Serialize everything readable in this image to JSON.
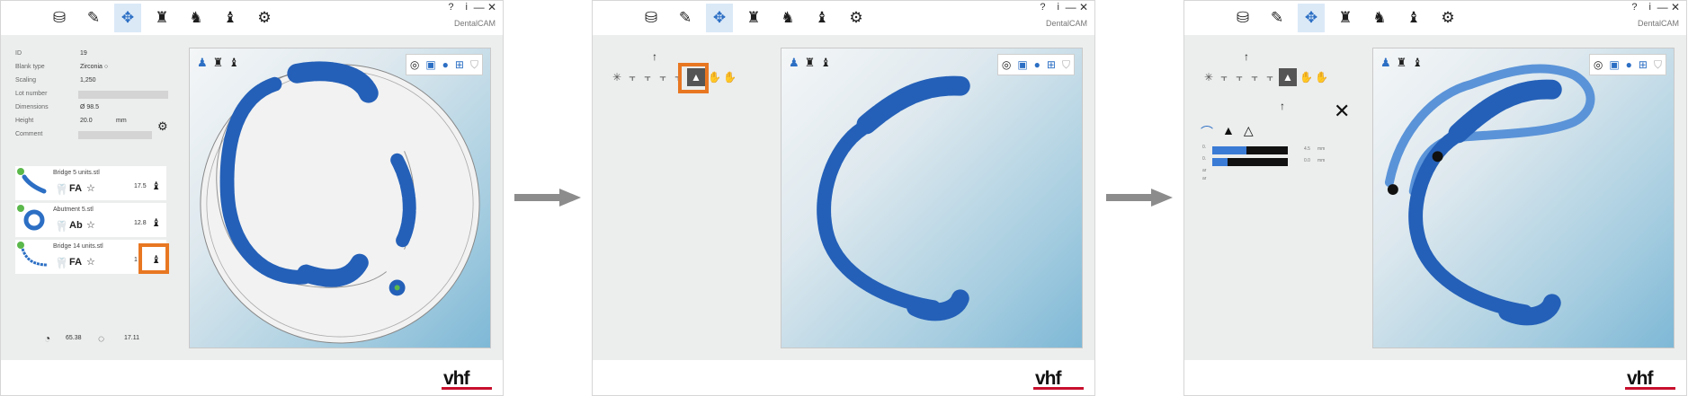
{
  "app": {
    "name": "DentalCAM",
    "help": "? i",
    "close": "— ✕",
    "logo": "vhf",
    "accent": "#2c6fc4",
    "highlight": "#e87722"
  },
  "toolbar_icons": [
    "database-icon",
    "clamp-icon",
    "position-icon",
    "tooth-add-icon",
    "tooth-pen-icon",
    "tooth-export-icon",
    "gear-icon"
  ],
  "blank_info": {
    "rows": [
      {
        "label": "ID",
        "value": "19"
      },
      {
        "label": "Blank type",
        "value": "Zirconia ○"
      },
      {
        "label": "Scaling",
        "value": "1,250"
      },
      {
        "label": "Lot number",
        "value": ""
      },
      {
        "label": "Dimensions",
        "value": "Ø 98.5"
      },
      {
        "label": "Height",
        "value": "20.0",
        "unit": "mm"
      },
      {
        "label": "Comment",
        "value": ""
      }
    ]
  },
  "jobs": [
    {
      "name": "Bridge 5 units.stl",
      "type": "FA",
      "number": "17.5"
    },
    {
      "name": "Abutment 5.stl",
      "type": "Ab",
      "number": "12.8"
    },
    {
      "name": "Bridge 14 units.stl",
      "type": "FA",
      "number": "1"
    }
  ],
  "timers": {
    "calc_time": "65.38",
    "mill_time": "17.11"
  },
  "params": {
    "rows": [
      {
        "label": "0.",
        "fill": 0.45,
        "value": "4.5",
        "unit": "mm"
      },
      {
        "label": "0.",
        "fill": 0.2,
        "value": "0.0",
        "unit": "mm"
      }
    ],
    "extra_labels": [
      "ar",
      "ar"
    ]
  }
}
